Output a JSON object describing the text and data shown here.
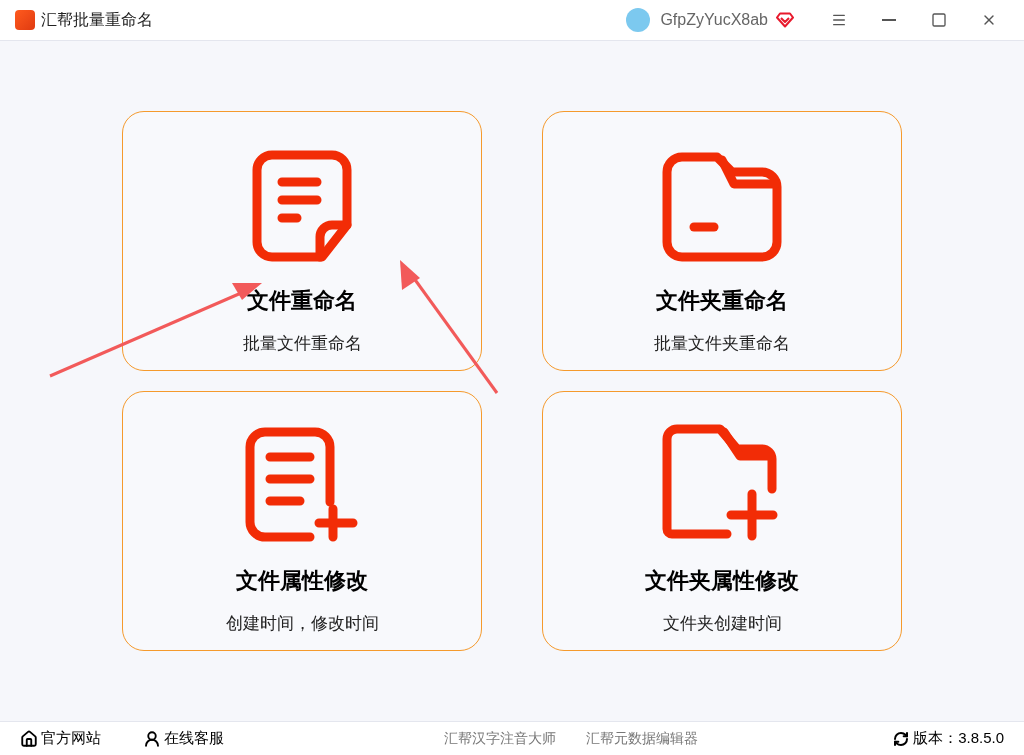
{
  "window": {
    "title": "汇帮批量重命名",
    "user": "GfpZyYucX8ab"
  },
  "cards": [
    {
      "kind": "file",
      "title": "文件重命名",
      "subtitle": "批量文件重命名"
    },
    {
      "kind": "folder",
      "title": "文件夹重命名",
      "subtitle": "批量文件夹重命名"
    },
    {
      "kind": "file-plus",
      "title": "文件属性修改",
      "subtitle": "创建时间，修改时间"
    },
    {
      "kind": "folder-plus",
      "title": "文件夹属性修改",
      "subtitle": "文件夹创建时间"
    }
  ],
  "footer": {
    "left": [
      {
        "kind": "home",
        "label": "官方网站"
      },
      {
        "kind": "support",
        "label": "在线客服"
      }
    ],
    "links": [
      "汇帮汉字注音大师",
      "汇帮元数据编辑器"
    ],
    "version": "版本：3.8.5.0"
  }
}
